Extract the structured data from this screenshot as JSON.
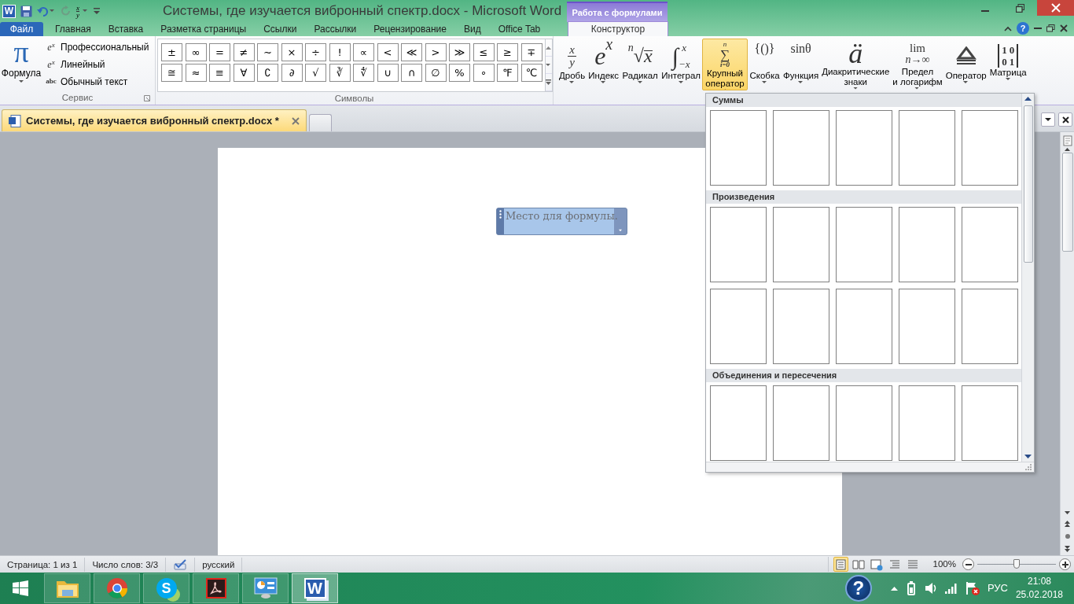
{
  "window": {
    "title": "Системы, где изучается вибронный спектр.docx  -  Microsoft Word",
    "app_glyph": "W"
  },
  "quick_access": [
    {
      "kind": "save",
      "disabled": false
    },
    {
      "kind": "undo",
      "disabled": false
    },
    {
      "kind": "redo",
      "disabled": true
    },
    {
      "kind": "equation",
      "glyphs": [
        "x",
        "y"
      ],
      "disabled": false
    },
    {
      "kind": "customize",
      "disabled": false
    }
  ],
  "contextual_group": "Работа с формулами",
  "ribbon_tabs": [
    {
      "label": "Файл",
      "kind": "file",
      "selected": false
    },
    {
      "label": "Главная",
      "kind": "tab",
      "selected": false
    },
    {
      "label": "Вставка",
      "kind": "tab",
      "selected": false
    },
    {
      "label": "Разметка страницы",
      "kind": "tab",
      "selected": false
    },
    {
      "label": "Ссылки",
      "kind": "tab",
      "selected": false
    },
    {
      "label": "Рассылки",
      "kind": "tab",
      "selected": false
    },
    {
      "label": "Рецензирование",
      "kind": "tab",
      "selected": false
    },
    {
      "label": "Вид",
      "kind": "tab",
      "selected": false
    },
    {
      "label": "Office Tab",
      "kind": "tab",
      "selected": false
    },
    {
      "label": "Конструктор",
      "kind": "contextual",
      "selected": true
    }
  ],
  "help_glyph": "?",
  "service": {
    "formula": {
      "glyph": "π",
      "label": "Формула"
    },
    "options": [
      {
        "icon_text": "e$^{x}$",
        "label": "Профессиональный"
      },
      {
        "icon_text": "e$^{x}$",
        "label": "Линейный"
      },
      {
        "icon_text": "abc",
        "label": "Обычный текст"
      }
    ],
    "group_label": "Сервис"
  },
  "symbols": {
    "items": [
      "±",
      "∞",
      "=",
      "≠",
      "∼",
      "×",
      "÷",
      "!",
      "∝",
      "<",
      "≪",
      ">",
      "≫",
      "≤",
      "≥",
      "∓",
      "≅",
      "≈",
      "≡",
      "∀",
      "∁",
      "∂",
      "√",
      "∛",
      "∜",
      "∪",
      "∩",
      "∅",
      "%",
      "∘",
      "℉",
      "℃"
    ],
    "group_label": "Символы"
  },
  "structures": [
    {
      "kind": "fraction",
      "glyphs": [
        "x",
        "y"
      ],
      "label": "Дробь",
      "selected": false
    },
    {
      "kind": "script",
      "glyphs": [
        "e",
        "x"
      ],
      "label": "Индекс",
      "selected": false
    },
    {
      "kind": "radical",
      "glyphs": [
        "n",
        "√",
        "x"
      ],
      "label": "Радикал",
      "selected": false
    },
    {
      "kind": "integral",
      "glyphs": [
        "∫",
        "x",
        "−x"
      ],
      "label": "Интеграл",
      "selected": false
    },
    {
      "kind": "large_operator",
      "glyphs": [
        "n",
        "∑",
        "i=0"
      ],
      "label": "Крупный оператор",
      "selected": true
    },
    {
      "kind": "plain",
      "glyphs": [
        "{()}"
      ],
      "label": "Скобка",
      "selected": false
    },
    {
      "kind": "plain",
      "glyphs": [
        "sinθ"
      ],
      "label": "Функция",
      "selected": false
    },
    {
      "kind": "accent",
      "glyphs": [
        "ä"
      ],
      "label": "Диакритические знаки",
      "selected": false
    },
    {
      "kind": "limit",
      "glyphs": [
        "lim",
        "n→∞"
      ],
      "label": "Предел и логарифм",
      "selected": false
    },
    {
      "kind": "triangle",
      "label": "Оператор",
      "selected": false
    },
    {
      "kind": "matrix",
      "glyphs": [
        "1",
        "0",
        "0",
        "1"
      ],
      "label": "Матрица",
      "selected": false
    }
  ],
  "document_tabs": [
    {
      "kind": "document",
      "label": "Системы, где изучается вибронный спектр.docx *",
      "selected": true
    },
    {
      "kind": "new",
      "selected": false
    }
  ],
  "formula_placeholder": "Место для формулы.",
  "gallery": {
    "sections": [
      {
        "title": "Суммы",
        "tiles": [
          {
            "kind": "blank"
          },
          {
            "kind": "blank"
          },
          {
            "kind": "blank"
          },
          {
            "kind": "blank"
          },
          {
            "kind": "blank"
          }
        ]
      },
      {
        "title": "Произведения",
        "tiles": [
          {
            "kind": "blank"
          },
          {
            "kind": "blank"
          },
          {
            "kind": "blank"
          },
          {
            "kind": "blank"
          },
          {
            "kind": "blank"
          },
          {
            "kind": "blank"
          },
          {
            "kind": "blank"
          },
          {
            "kind": "blank"
          },
          {
            "kind": "blank"
          },
          {
            "kind": "blank"
          }
        ]
      },
      {
        "title": "Объединения и пересечения",
        "tiles": [
          {
            "kind": "blank"
          },
          {
            "kind": "blank"
          },
          {
            "kind": "blank"
          },
          {
            "kind": "blank"
          },
          {
            "kind": "blank"
          }
        ]
      }
    ]
  },
  "status_bar": {
    "page": "Страница: 1 из 1",
    "words": "Число слов: 3/3",
    "language": "русский",
    "views": [
      {
        "kind": "print",
        "selected": true
      },
      {
        "kind": "reading",
        "selected": false
      },
      {
        "kind": "web",
        "selected": false
      },
      {
        "kind": "outline",
        "selected": false
      },
      {
        "kind": "draft",
        "selected": false
      }
    ],
    "zoom": "100%",
    "zoom_slider": {
      "level": 0.5
    }
  },
  "taskbar": {
    "items": [
      {
        "kind": "start"
      },
      {
        "kind": "explorer",
        "selected": false
      },
      {
        "kind": "browser",
        "selected": false
      },
      {
        "kind": "skype",
        "glyph": "S",
        "selected": false
      },
      {
        "kind": "acrobat",
        "selected": false
      },
      {
        "kind": "control_panel",
        "selected": false
      },
      {
        "kind": "word",
        "glyph": "W",
        "selected": true
      }
    ],
    "tray": {
      "help_glyph": "?",
      "language": "РУС",
      "time": "21:08",
      "date": "25.02.2018"
    }
  }
}
